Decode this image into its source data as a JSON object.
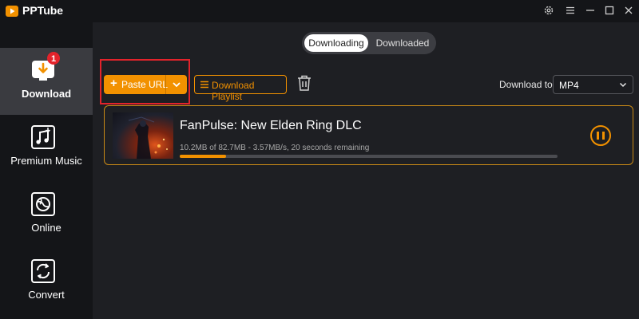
{
  "app": {
    "title": "PPTube",
    "accent_color": "#f29100"
  },
  "window_controls": [
    {
      "icon": "gear-icon"
    },
    {
      "icon": "menu-icon"
    },
    {
      "icon": "minimize-icon"
    },
    {
      "icon": "maximize-icon"
    },
    {
      "icon": "close-icon"
    }
  ],
  "sidebar": {
    "items": [
      {
        "label": "Download",
        "icon": "download-icon",
        "badge": "1",
        "active": true
      },
      {
        "label": "Premium Music",
        "icon": "music-icon",
        "active": false
      },
      {
        "label": "Online",
        "icon": "globe-icon",
        "active": false
      },
      {
        "label": "Convert",
        "icon": "convert-icon",
        "active": false
      }
    ]
  },
  "tabs": [
    {
      "label": "Downloading",
      "active": true
    },
    {
      "label": "Downloaded",
      "active": false
    }
  ],
  "toolbar": {
    "paste_url_label": "Paste URL",
    "download_playlist_label": "Download Playlist",
    "download_to_label": "Download to",
    "format_value": "MP4"
  },
  "downloads": [
    {
      "title": "FanPulse: New Elden Ring DLC",
      "progress_text": "10.2MB of 82.7MB -   3.57MB/s, 20 seconds remaining",
      "progress_fraction": 0.123
    }
  ]
}
